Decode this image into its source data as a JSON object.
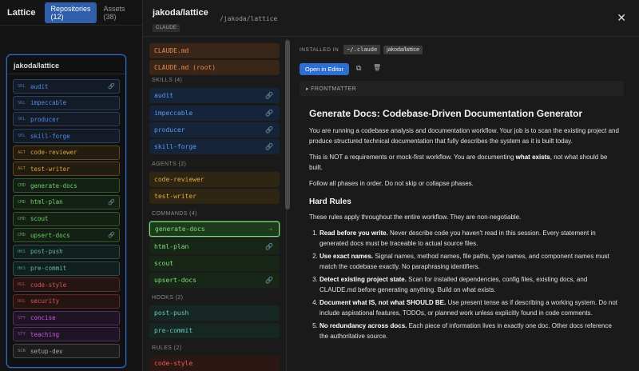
{
  "app": {
    "title": "Lattice",
    "tabs": [
      {
        "label": "Repositories (12)",
        "active": true
      },
      {
        "label": "Assets (38)",
        "active": false
      }
    ],
    "panel_title": "jakoda/lattice",
    "items": [
      {
        "type": "SKL",
        "name": "audit",
        "color": "#4a8eea",
        "bg": "#141b27",
        "link": true
      },
      {
        "type": "SKL",
        "name": "impeccable",
        "color": "#4a8eea",
        "bg": "#141b27",
        "link": false
      },
      {
        "type": "SKL",
        "name": "producer",
        "color": "#4a8eea",
        "bg": "#141b27",
        "link": false
      },
      {
        "type": "SKL",
        "name": "skill-forge",
        "color": "#4a8eea",
        "bg": "#141b27",
        "link": false
      },
      {
        "type": "AGT",
        "name": "code-reviewer",
        "color": "#e0a33a",
        "bg": "#221c11",
        "link": false
      },
      {
        "type": "AGT",
        "name": "test-writer",
        "color": "#e0a33a",
        "bg": "#221c11",
        "link": false
      },
      {
        "type": "CMD",
        "name": "generate-docs",
        "color": "#6fd46a",
        "bg": "#132013",
        "link": false
      },
      {
        "type": "CMD",
        "name": "html-plan",
        "color": "#6fd46a",
        "bg": "#132013",
        "link": true
      },
      {
        "type": "CMD",
        "name": "scout",
        "color": "#6fd46a",
        "bg": "#132013",
        "link": false
      },
      {
        "type": "CMD",
        "name": "upsert-docs",
        "color": "#6fd46a",
        "bg": "#132013",
        "link": true
      },
      {
        "type": "HKS",
        "name": "post-push",
        "color": "#5fb7a8",
        "bg": "#11201e",
        "link": false
      },
      {
        "type": "HKS",
        "name": "pre-commit",
        "color": "#5fb7a8",
        "bg": "#11201e",
        "link": false
      },
      {
        "type": "RUL",
        "name": "code-style",
        "color": "#e0584d",
        "bg": "#241413",
        "link": false
      },
      {
        "type": "RUL",
        "name": "security",
        "color": "#e0584d",
        "bg": "#241413",
        "link": false
      },
      {
        "type": "STY",
        "name": "concise",
        "color": "#c05fdc",
        "bg": "#1f1424",
        "link": false
      },
      {
        "type": "STY",
        "name": "teaching",
        "color": "#c05fdc",
        "bg": "#1f1424",
        "link": false
      },
      {
        "type": "SCR",
        "name": "setup-dev",
        "color": "#a8a8a8",
        "bg": "#1c1c1c",
        "link": false
      }
    ]
  },
  "overlay": {
    "title": "jakoda/lattice",
    "badge": "CLAUDE",
    "path": "/jakoda/lattice",
    "close": "✕",
    "files": [
      {
        "kind": "item",
        "name": "CLAUDE.md",
        "color": "#e8894a",
        "bg": "#3a2619"
      },
      {
        "kind": "item",
        "name": "CLAUDE.md (root)",
        "color": "#e8894a",
        "bg": "#3a2619"
      },
      {
        "kind": "section",
        "label": "SKILLS (4)"
      },
      {
        "kind": "item",
        "name": "audit",
        "color": "#5a9af0",
        "bg": "#16243a",
        "link": true
      },
      {
        "kind": "item",
        "name": "impeccable",
        "color": "#5a9af0",
        "bg": "#16243a",
        "link": true
      },
      {
        "kind": "item",
        "name": "producer",
        "color": "#5a9af0",
        "bg": "#16243a",
        "link": true
      },
      {
        "kind": "item",
        "name": "skill-forge",
        "color": "#5a9af0",
        "bg": "#16243a",
        "link": true
      },
      {
        "kind": "section",
        "label": "AGENTS (2)",
        "gap": true
      },
      {
        "kind": "item",
        "name": "code-reviewer",
        "color": "#e8a844",
        "bg": "#2e2513"
      },
      {
        "kind": "item",
        "name": "test-writer",
        "color": "#e8a844",
        "bg": "#2e2513"
      },
      {
        "kind": "section",
        "label": "COMMANDS (4)",
        "gap": true
      },
      {
        "kind": "item",
        "name": "generate-docs",
        "color": "#7de07a",
        "bg": "#1d3a1c",
        "selected": true,
        "arrow": "→"
      },
      {
        "kind": "item",
        "name": "html-plan",
        "color": "#7de07a",
        "bg": "#172617",
        "link": true
      },
      {
        "kind": "item",
        "name": "scout",
        "color": "#7de07a",
        "bg": "#172617"
      },
      {
        "kind": "item",
        "name": "upsert-docs",
        "color": "#7de07a",
        "bg": "#172617",
        "link": true
      },
      {
        "kind": "section",
        "label": "HOOKS (2)",
        "gap": true
      },
      {
        "kind": "item",
        "name": "post-push",
        "color": "#6cc6b6",
        "bg": "#152623"
      },
      {
        "kind": "item",
        "name": "pre-commit",
        "color": "#6cc6b6",
        "bg": "#152623"
      },
      {
        "kind": "section",
        "label": "RULES (2)",
        "gap": true
      },
      {
        "kind": "item",
        "name": "code-style",
        "color": "#e8604f",
        "bg": "#2d1715"
      }
    ],
    "detail": {
      "installed_label": "INSTALLED IN",
      "chips": [
        "~/.claude",
        "jakoda/lattice"
      ],
      "open_label": "Open in Editor",
      "copy_icon": "⧉",
      "trash_icon": "🗑",
      "frontmatter": "▸ FRONTMATTER",
      "doc": {
        "h1": "Generate Docs: Codebase-Driven Documentation Generator",
        "p1": "You are running a codebase analysis and documentation workflow. Your job is to scan the existing project and produce structured technical documentation that fully describes the system as it is built today.",
        "p2_a": "This is NOT a requirements or mock-first workflow. You are documenting ",
        "p2_b": "what exists",
        "p2_c": ", not what should be built.",
        "p3": "Follow all phases in order. Do not skip or collapse phases.",
        "h2": "Hard Rules",
        "p4": "These rules apply throughout the entire workflow. They are non-negotiable.",
        "rules": [
          {
            "b": "Read before you write.",
            "t": " Never describe code you haven't read in this session. Every statement in generated docs must be traceable to actual source files."
          },
          {
            "b": "Use exact names.",
            "t": " Signal names, method names, file paths, type names, and component names must match the codebase exactly. No paraphrasing identifiers."
          },
          {
            "b": "Detect existing project state.",
            "t": " Scan for installed dependencies, config files, existing docs, and CLAUDE.md before generating anything. Build on what exists."
          },
          {
            "b": "Document what IS, not what SHOULD BE.",
            "t": " Use present tense as if describing a working system. Do not include aspirational features, TODOs, or planned work unless explicitly found in code comments."
          },
          {
            "b": "No redundancy across docs.",
            "t": " Each piece of information lives in exactly one doc. Other docs reference the authoritative source."
          }
        ]
      }
    }
  }
}
